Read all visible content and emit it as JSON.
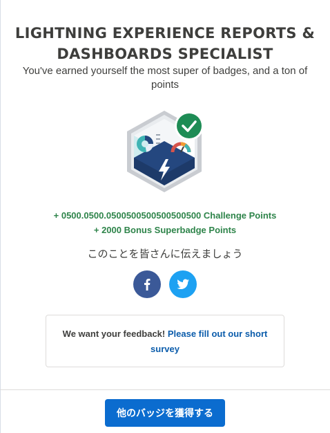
{
  "modal": {
    "title_line1": "LIGHTNING EXPERIENCE REPORTS &",
    "title_line2": "DASHBOARDS SPECIALIST",
    "subtitle": "You've earned yourself the most super of badges, and a ton of points"
  },
  "badge": {
    "icon": "superbadge-reports-dashboards-icon",
    "check_icon": "checkmark-icon",
    "colors": {
      "check": "#1e8c55",
      "hex_border": "#c9ccd1",
      "base": "#24477f",
      "teal": "#3fb4b4"
    }
  },
  "points": {
    "challenge": "+ 0500.0500.0500500500500500500 Challenge Points",
    "bonus": "+ 2000 Bonus Superbadge Points"
  },
  "share": {
    "text": "このことを皆さんに伝えましょう",
    "facebook_icon": "facebook-icon",
    "twitter_icon": "twitter-icon"
  },
  "feedback": {
    "prefix": "We want your feedback!",
    "link_text": "Please fill out our short survey"
  },
  "footer": {
    "cta_label": "他のバッジを獲得する"
  },
  "colors": {
    "points_green": "#2e844a",
    "link_blue": "#0b5cab",
    "button_blue": "#0b6ccf",
    "facebook": "#3b5998",
    "twitter": "#1da1f2"
  }
}
